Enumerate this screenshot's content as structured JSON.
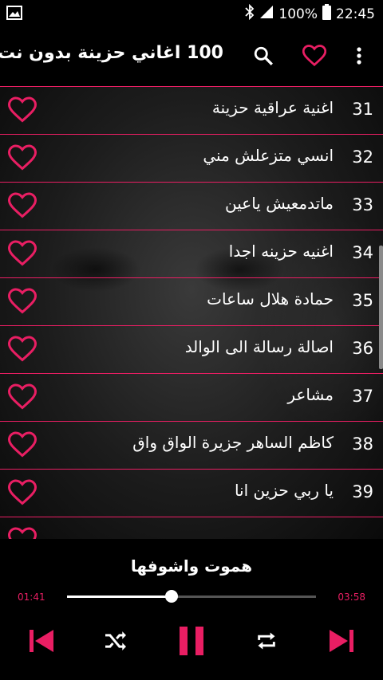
{
  "status": {
    "battery": "100%",
    "time": "22:45"
  },
  "header": {
    "title": "100 اغاني حزينة بدون نت"
  },
  "songs": [
    {
      "num": "31",
      "name": "اغنية عراقية حزينة"
    },
    {
      "num": "32",
      "name": "انسي متزعلش مني"
    },
    {
      "num": "33",
      "name": "ماتدمعيش ياعين"
    },
    {
      "num": "34",
      "name": "اغنيه حزينه اجدا"
    },
    {
      "num": "35",
      "name": "حمادة هلال ساعات"
    },
    {
      "num": "36",
      "name": "اصالة رسالة الى الوالد"
    },
    {
      "num": "37",
      "name": "مشاعر"
    },
    {
      "num": "38",
      "name": "كاظم الساهر جزيرة الواق واق"
    },
    {
      "num": "39",
      "name": "يا ربي حزين انا"
    }
  ],
  "player": {
    "current_song": "هموت واشوفها",
    "elapsed": "01:41",
    "total": "03:58",
    "progress_fraction": 0.42
  },
  "colors": {
    "accent": "#e91e63",
    "background": "#000000"
  },
  "icons": [
    "image-icon",
    "bluetooth-icon",
    "signal-icon",
    "battery-icon",
    "search-icon",
    "favorite-heart-icon",
    "more-vert-icon",
    "heart-outline-icon",
    "skip-previous-icon",
    "shuffle-icon",
    "pause-icon",
    "repeat-icon",
    "skip-next-icon"
  ]
}
